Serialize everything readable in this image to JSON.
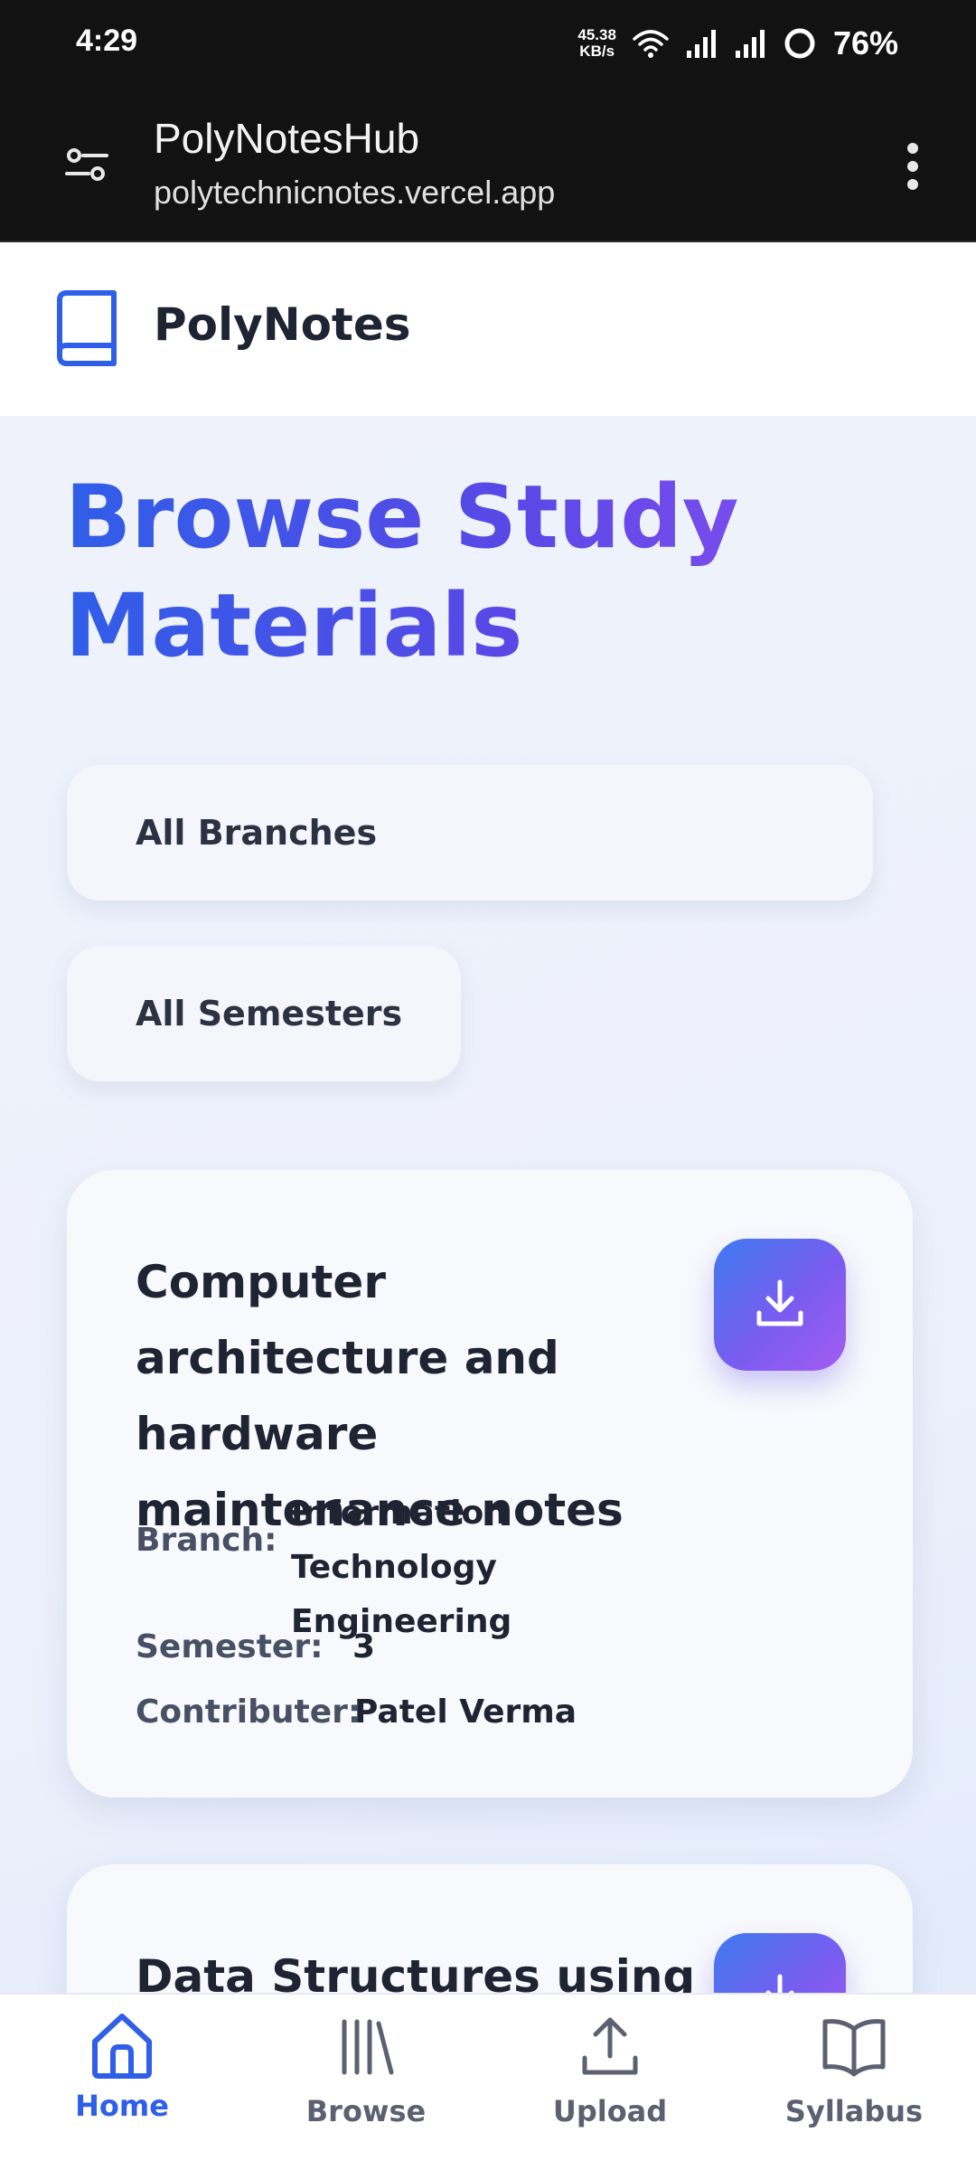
{
  "status_bar": {
    "time": "4:29",
    "net_speed_value": "45.38",
    "net_speed_unit": "KB/s",
    "battery": "76%"
  },
  "browser": {
    "title": "PolyNotesHub",
    "url": "polytechnicnotes.vercel.app"
  },
  "header": {
    "brand": "PolyNotes"
  },
  "main": {
    "title": "Browse Study Materials",
    "filters": {
      "branch": "All Branches",
      "semester": "All Semesters"
    },
    "cards": [
      {
        "title": "Computer architecture and hardware maintenance notes",
        "branch_label": "Branch:",
        "branch": "Information Technology Engineering",
        "semester_label": "Semester:",
        "semester": "3",
        "contributor_label": "Contributer:",
        "contributor": "Patel Verma"
      },
      {
        "title": "Data Structures using C"
      }
    ]
  },
  "nav": {
    "items": [
      {
        "label": "Home",
        "icon": "home-icon",
        "active": true
      },
      {
        "label": "Browse",
        "icon": "library-icon",
        "active": false
      },
      {
        "label": "Upload",
        "icon": "upload-icon",
        "active": false
      },
      {
        "label": "Syllabus",
        "icon": "book-open-icon",
        "active": false
      }
    ]
  },
  "colors": {
    "accent": "#2f5ee8",
    "gradient_end": "#a45cf0",
    "status_bar": "#121212"
  }
}
